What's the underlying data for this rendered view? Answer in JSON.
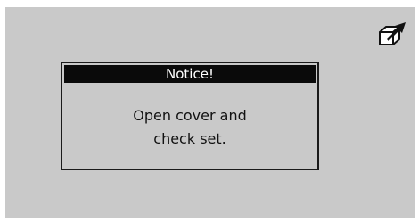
{
  "status_bar": {
    "icon": "eject-tray-icon"
  },
  "notice": {
    "title": "Notice!",
    "message_line1": "Open cover and",
    "message_line2": "check set."
  },
  "colors": {
    "screen_background": "#c9c9c9",
    "title_bar": "#0a0a0a",
    "title_text": "#ffffff",
    "text": "#111111"
  }
}
